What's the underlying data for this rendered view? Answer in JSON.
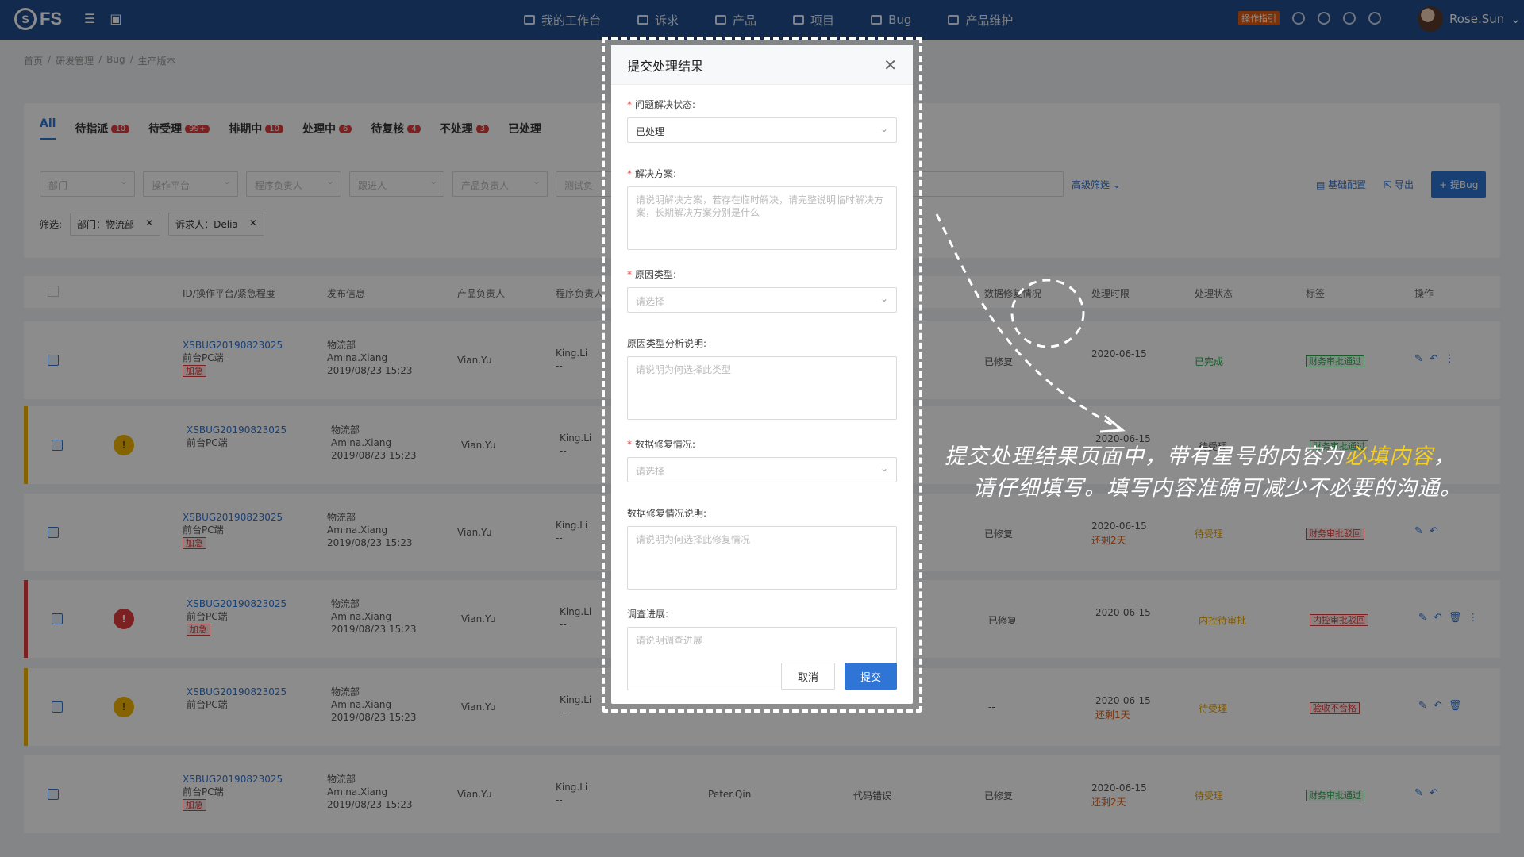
{
  "app": {
    "logo_text": "FS"
  },
  "nav": {
    "items": [
      "我的工作台",
      "诉求",
      "产品",
      "项目",
      "Bug",
      "产品维护"
    ],
    "guide_label": "操作指引",
    "user_name": "Rose.Sun"
  },
  "breadcrumb": [
    "首页",
    "研发管理",
    "Bug",
    "生产版本"
  ],
  "tabs": [
    {
      "label": "All",
      "count": ""
    },
    {
      "label": "待指派",
      "count": "10"
    },
    {
      "label": "待受理",
      "count": "99+"
    },
    {
      "label": "排期中",
      "count": "10"
    },
    {
      "label": "处理中",
      "count": "6"
    },
    {
      "label": "待复核",
      "count": "4"
    },
    {
      "label": "不处理",
      "count": "3"
    },
    {
      "label": "已处理",
      "count": ""
    }
  ],
  "filters": {
    "selects": [
      "部门",
      "操作平台",
      "程序负责人",
      "跟进人",
      "产品负责人",
      "测试负"
    ],
    "advanced": "高级筛选",
    "basic_config": "基础配置",
    "export": "导出",
    "add_bug": "+ 提Bug",
    "chip_prefix": "筛选:",
    "chips": [
      "部门：物流部",
      "诉求人：Delia"
    ]
  },
  "table": {
    "headers": [
      "ID/操作平台/紧急程度",
      "发布信息",
      "产品负责人",
      "程序负责人",
      "数据修复情况",
      "处理时限",
      "处理状态",
      "标签",
      "操作"
    ],
    "rows": [
      {
        "id": "XSBUG20190823025",
        "platform": "前台PC端",
        "urgent": "加急",
        "dept": "物流部",
        "pub_user": "Amina.Xiang",
        "pub_time": "2019/08/23 15:23",
        "owner": "Vian.Yu",
        "prog": "King.Li",
        "prog2": "--",
        "repair": "已修复",
        "date": "2020-06-15",
        "left": "",
        "status": "已完成",
        "label": "财务审批通过"
      },
      {
        "id": "XSBUG20190823025",
        "platform": "前台PC端",
        "urgent": "",
        "dept": "物流部",
        "pub_user": "Amina.Xiang",
        "pub_time": "2019/08/23 15:23",
        "owner": "Vian.Yu",
        "prog": "King.Li",
        "prog2": "--",
        "repair": "",
        "date": "2020-06-15",
        "left": "",
        "status": "待受理",
        "label": "财务审批通过"
      },
      {
        "id": "XSBUG20190823025",
        "platform": "前台PC端",
        "urgent": "加急",
        "dept": "物流部",
        "pub_user": "Amina.Xiang",
        "pub_time": "2019/08/23 15:23",
        "owner": "Vian.Yu",
        "prog": "King.Li",
        "prog2": "--",
        "repair": "已修复",
        "date": "2020-06-15",
        "left": "还剩2天",
        "status": "待受理",
        "label": "财务审批驳回"
      },
      {
        "id": "XSBUG20190823025",
        "platform": "前台PC端",
        "urgent": "加急",
        "dept": "物流部",
        "pub_user": "Amina.Xiang",
        "pub_time": "2019/08/23 15:23",
        "owner": "Vian.Yu",
        "prog": "King.Li",
        "prog2": "--",
        "repair": "已修复",
        "date": "2020-06-15",
        "left": "",
        "status": "内控待审批",
        "label": "内控审批驳回"
      },
      {
        "id": "XSBUG20190823025",
        "platform": "前台PC端",
        "urgent": "",
        "dept": "物流部",
        "pub_user": "Amina.Xiang",
        "pub_time": "2019/08/23 15:23",
        "owner": "Vian.Yu",
        "prog": "King.Li",
        "prog2": "--",
        "repair": "--",
        "date": "2020-06-15",
        "left": "还剩1天",
        "status": "待受理",
        "label": "验收不合格"
      },
      {
        "id": "XSBUG20190823025",
        "platform": "前台PC端",
        "urgent": "加急",
        "dept": "物流部",
        "pub_user": "Amina.Xiang",
        "pub_time": "2019/08/23 15:23",
        "owner": "Vian.Yu",
        "prog": "King.Li",
        "prog2": "--",
        "repair": "已修复",
        "date": "2020-06-15",
        "left": "还剩2天",
        "status": "待受理",
        "label": "财务审批通过",
        "tester": "Peter.Qin",
        "reason": "代码错误"
      }
    ]
  },
  "modal": {
    "title": "提交处理结果",
    "fields": {
      "status_label": "问题解决状态:",
      "status_value": "已处理",
      "solution_label": "解决方案:",
      "solution_placeholder": "请说明解决方案，若存在临时解决，请完整说明临时解决方案，长期解决方案分别是什么",
      "reason_type_label": "原因类型:",
      "reason_type_placeholder": "请选择",
      "reason_analysis_label": "原因类型分析说明:",
      "reason_analysis_placeholder": "请说明为何选择此类型",
      "repair_label": "数据修复情况:",
      "repair_placeholder": "请选择",
      "repair_desc_label": "数据修复情况说明:",
      "repair_desc_placeholder": "请说明为何选择此修复情况",
      "progress_label": "调查进展:",
      "progress_placeholder": "请说明调查进展"
    },
    "cancel_label": "取消",
    "submit_label": "提交"
  },
  "annotation": {
    "line1_a": "提交处理结果页面中，带有星号的内容为",
    "line1_hl": "必填内容",
    "line1_b": "，",
    "line2": "请仔细填写。填写内容准确可减少不必要的沟通。"
  }
}
